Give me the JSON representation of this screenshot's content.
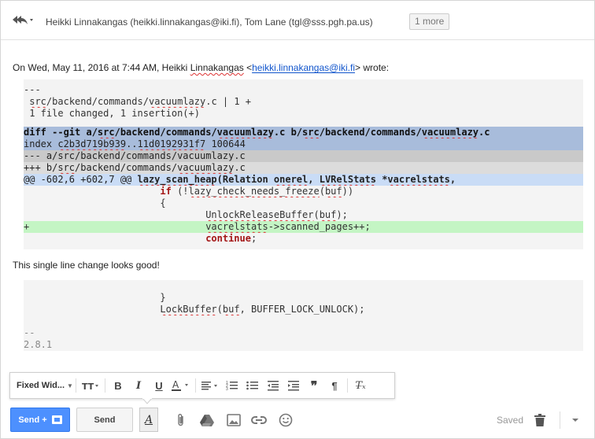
{
  "header": {
    "recipients": "Heikki Linnakangas (heikki.linnakangas@iki.fi), Tom Lane (tgl@sss.pgh.pa.us)",
    "more_label": "1 more"
  },
  "quote_intro": {
    "prefix": "On Wed, May 11, 2016 at 7:44 AM, ",
    "name_first": "Heikki",
    "name_last": "Linnakangas",
    "lt": " <",
    "email": "heikki.linnakangas@iki.fi",
    "suffix": "> wrote:"
  },
  "patch": {
    "l1": "---",
    "l2_a": " ",
    "l2_b": "src",
    "l2_c": "/backend/commands/",
    "l2_d": "vacuumlazy",
    "l2_e": ".c | 1 +",
    "l3": " 1 file changed, 1 insertion(+)",
    "diff_a": "diff --git a/",
    "diff_b": "src",
    "diff_c": "/backend/commands/",
    "diff_d": "vacuumlazy",
    "diff_e": ".c b/",
    "diff_f": "src",
    "diff_g": "/backend/commands/",
    "diff_h": "vacuumlazy",
    "diff_i": ".c",
    "idx_a": "index ",
    "idx_b": "c2b3d719b939",
    "idx_c": "..",
    "idx_d": "11d0192931f7",
    "idx_e": " 100644",
    "minus_line": "--- a/src/backend/commands/vacuumlazy.c",
    "plus_a": "+++ b/",
    "plus_b": "src",
    "plus_c": "/backend/commands/",
    "plus_d": "vacuumlazy",
    "plus_e": ".c",
    "hunk_a": "@@ -602,6 +602,7 @@ ",
    "hunk_b": "lazy_scan_heap",
    "hunk_c": "(Relation ",
    "hunk_d": "onerel",
    "hunk_e": ", ",
    "hunk_f": "LVRelStats",
    "hunk_g": " *",
    "hunk_h": "vacrelstats",
    "hunk_i": ",",
    "ctx1_indent": "                        ",
    "ctx1_kw": "if",
    "ctx1_a": " (!",
    "ctx1_b": "lazy_check_needs_freeze",
    "ctx1_c": "(",
    "ctx1_d": "buf",
    "ctx1_e": "))",
    "ctx2": "                        {",
    "ctx3_indent": "                                ",
    "ctx3_a": "UnlockReleaseBuffer",
    "ctx3_b": "(",
    "ctx3_c": "buf",
    "ctx3_d": ");",
    "add_plus": "+",
    "add_indent": "                               ",
    "add_a": "vacrelstats",
    "add_b": "->scanned_pages++;",
    "ctx4_indent": "                                ",
    "ctx4_kw": "continue",
    "ctx4_b": ";"
  },
  "message_2": "This single line change looks good!",
  "patch2": {
    "l1": "                        }",
    "l2_indent": "                        ",
    "l2_a": "LockBuffer",
    "l2_b": "(",
    "l2_c": "buf",
    "l2_d": ", BUFFER_LOCK_UNLOCK);",
    "sig1": "--",
    "sig2": "2.8.1"
  },
  "format_bar": {
    "font_label": "Fixed Wid..."
  },
  "toolbar": {
    "send_label": "Send +",
    "send_button_label": "Send",
    "saved_label": "Saved"
  }
}
